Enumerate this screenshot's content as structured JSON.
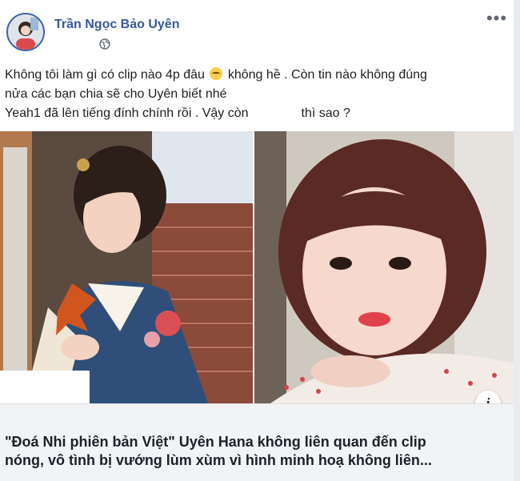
{
  "post": {
    "author": "Trần Ngọc Bảo Uyên",
    "more_label": "•••",
    "text_line1_a": "Không tôi làm gì có clip nào 4p đâu",
    "text_line1_b": "không hề . Còn tin nào không đúng",
    "text_line2": "nửa các bạn chia sẽ cho Uyên biết nhé",
    "text_line3_a": "Yeah1 đã lên tiếng đính chính rồi . Vậy còn",
    "text_line3_b": "thì sao ?",
    "emoji": "disappointed-face-icon",
    "privacy_icon": "globe-icon"
  },
  "media": {
    "info_label": "i"
  },
  "link_preview": {
    "title_line1": "\"Đoá Nhi phiên bản Việt\" Uyên Hana không liên quan đến clip",
    "title_line2": "nóng, vô tình bị vướng lùm xùm vì hình minh hoạ không liên..."
  },
  "colors": {
    "author": "#385898",
    "card_bg": "#f2f3f5",
    "text": "#1c1e21"
  }
}
